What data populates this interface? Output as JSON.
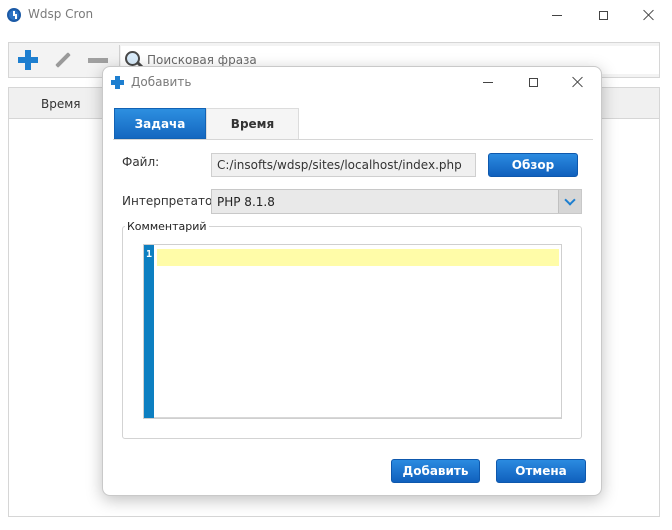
{
  "main_window": {
    "title": "Wdsp Cron",
    "search": {
      "placeholder": "Поисковая фраза",
      "value": ""
    },
    "list": {
      "columns": [
        "Время"
      ]
    }
  },
  "dialog": {
    "title": "Добавить",
    "tabs": [
      {
        "label": "Задача",
        "active": true
      },
      {
        "label": "Время",
        "active": false
      }
    ],
    "file": {
      "label": "Файл:",
      "value": "C:/insofts/wdsp/sites/localhost/index.php",
      "browse_label": "Обзор"
    },
    "interpreter": {
      "label": "Интерпретатор:",
      "selected": "PHP 8.1.8"
    },
    "comment": {
      "label": "Комментарий",
      "line_numbers": [
        "1"
      ],
      "content": ""
    },
    "buttons": {
      "add": "Добавить",
      "cancel": "Отмена"
    }
  },
  "colors": {
    "accent": "#1e7fd0",
    "gutter": "#0d7fc1",
    "current_line": "#fffca8"
  }
}
